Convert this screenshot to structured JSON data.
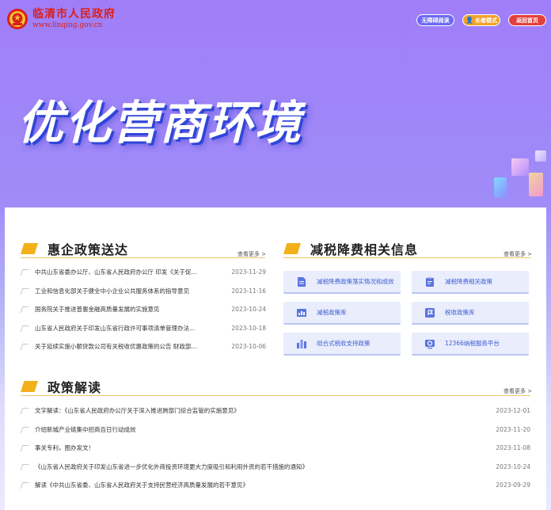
{
  "header": {
    "site_title": "临清市人民政府",
    "site_url": "www.linqing.gov.cn",
    "buttons": {
      "accessible": "无障碍阅读",
      "elder": "长者模式",
      "home": "返回首页"
    }
  },
  "hero": {
    "title": "优化营商环境"
  },
  "sections": {
    "enterprise": {
      "title": "惠企政策送达",
      "more": "查看更多 >",
      "items": [
        {
          "title": "中共山东省委办公厅、山东省人民政府办公厅 印发《关于促...",
          "date": "2023-11-29"
        },
        {
          "title": "工业和信息化部关于健全中小企业公共服务体系的指导意见",
          "date": "2023-11-16"
        },
        {
          "title": "国务院关于推进普惠金融高质量发展的实施意见",
          "date": "2023-10-24"
        },
        {
          "title": "山东省人民政府关于印发山东省行政许可事项清单管理办法...",
          "date": "2023-10-18"
        },
        {
          "title": "关于延续实施小额贷款公司有关税收优惠政策的公告 财政部...",
          "date": "2023-10-06"
        }
      ]
    },
    "tax": {
      "title": "减税降费相关信息",
      "more": "查看更多 >",
      "cards": [
        {
          "label": "减税降费政策落实情况和成效",
          "icon": "document-icon"
        },
        {
          "label": "减税降费相关政策",
          "icon": "clipboard-icon"
        },
        {
          "label": "减税政策库",
          "icon": "chart-document-icon"
        },
        {
          "label": "税收政策库",
          "icon": "flag-box-icon"
        },
        {
          "label": "组合式税收支持政策",
          "icon": "bar-chart-icon"
        },
        {
          "label": "12366纳税服务平台",
          "icon": "service-platform-icon"
        }
      ]
    },
    "interpretation": {
      "title": "政策解读",
      "more": "查看更多 >",
      "items": [
        {
          "title": "文字解读：《山东省人民政府办公厅关于深入推进跨部门综合监管的实施意见》",
          "date": "2023-12-01"
        },
        {
          "title": "介绍新城产业链集中招商百日行动成效",
          "date": "2023-11-20"
        },
        {
          "title": "事关专利，图办发文！",
          "date": "2023-11-08"
        },
        {
          "title": "《山东省人民政府关于印发山东省进一步优化外商投资环境更大力度吸引和利用外资的若干措施的通知》",
          "date": "2023-10-24"
        },
        {
          "title": "解读《中共山东省委、山东省人民政府关于支持民营经济高质量发展的若干意见》",
          "date": "2023-09-29"
        }
      ]
    }
  },
  "colors": {
    "brand_red": "#d9201c",
    "accent_gold": "#f2b01b",
    "card_blue": "#3c5cd0"
  }
}
